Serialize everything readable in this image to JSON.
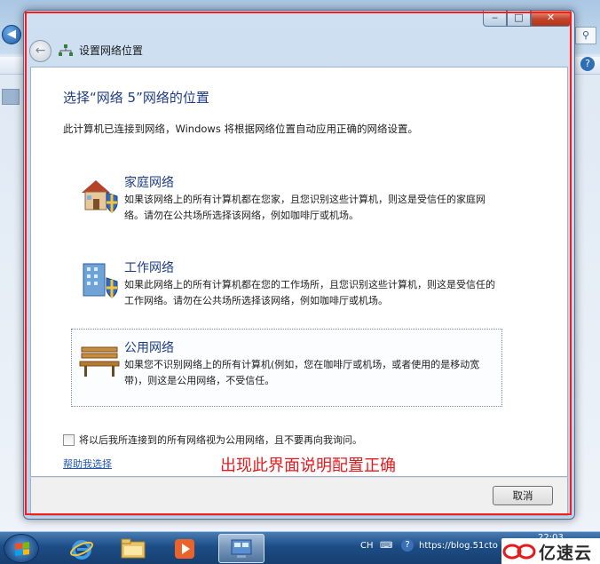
{
  "dialog": {
    "title": "设置网络位置",
    "heading": "选择“网络 5”网络的位置",
    "description": "此计算机已连接到网络，Windows 将根据网络位置自动应用正确的网络设置。",
    "caption_buttons": {
      "minimize": "‒",
      "maximize": "□",
      "close": "✕"
    }
  },
  "options": [
    {
      "title": "家庭网络",
      "description": "如果该网络上的所有计算机都在您家，且您识别这些计算机，则这是受信任的家庭网络。请勿在公共场所选择该网络，例如咖啡厅或机场。",
      "icon": "house-shield-icon"
    },
    {
      "title": "工作网络",
      "description": "如果此网络上的所有计算机都在您的工作场所，且您识别这些计算机，则这是受信任的工作网络。请勿在公共场所选择该网络，例如咖啡厅或机场。",
      "icon": "office-building-shield-icon"
    },
    {
      "title": "公用网络",
      "description": "如果您不识别网络上的所有计算机(例如，您在咖啡厅或机场，或者使用的是移动宽带)，则这是公用网络，不受信任。",
      "icon": "park-bench-icon",
      "selected": true
    }
  ],
  "checkbox": {
    "label": "将以后我所连接到的所有网络视为公用网络，且不要再向我询问。",
    "checked": false
  },
  "help_link": "帮助我选择",
  "annotation": {
    "text": "出现此界面说明配置正确",
    "color": "#e8191c"
  },
  "footer": {
    "cancel_label": "取消"
  },
  "taskbar": {
    "language": "CH",
    "time": "22:03",
    "url_fragment": "https://blog.51cto"
  },
  "watermark": {
    "text": "亿速云"
  },
  "colors": {
    "accent_heading": "#1e3d86",
    "link": "#1f55b5",
    "annotation_frame": "#ff1a1a"
  }
}
